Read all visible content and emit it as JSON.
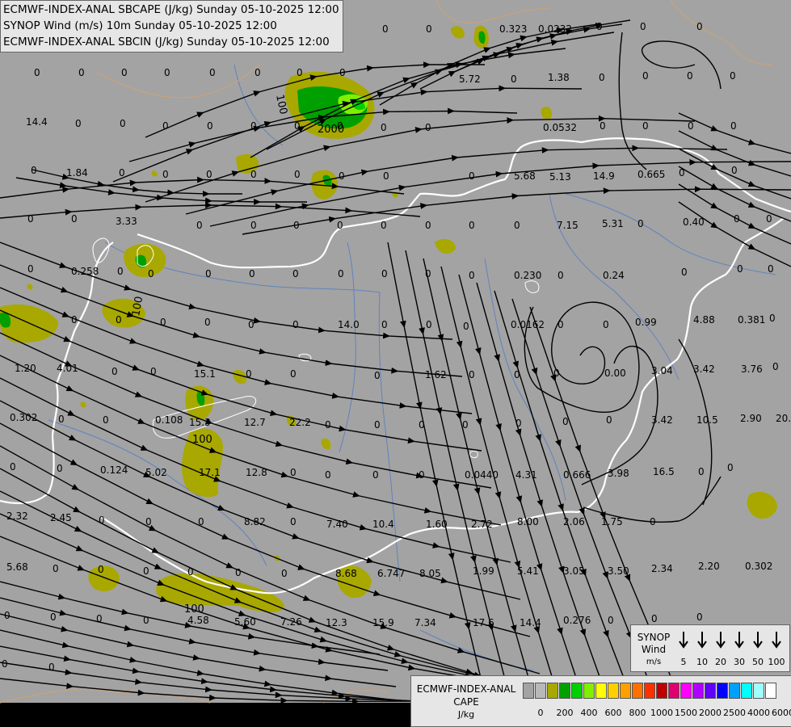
{
  "header": {
    "line1": "ECMWF-INDEX-ANAL SBCAPE (J/kg) Sunday 05-10-2025 12:00",
    "line2": "SYNOP Wind (m/s) 10m Sunday 05-10-2025 12:00",
    "line3": "ECMWF-INDEX-ANAL SBCIN (J/kg) Sunday 05-10-2025 12:00"
  },
  "wind_legend": {
    "title": "SYNOP",
    "subtitle": "Wind",
    "unit": "m/s",
    "speeds": [
      "5",
      "10",
      "20",
      "30",
      "50",
      "100"
    ]
  },
  "cape_legend": {
    "title": "ECMWF-INDEX-ANAL",
    "subtitle": "CAPE",
    "unit": "J/kg",
    "tick_labels": [
      "0",
      "200",
      "400",
      "600",
      "800",
      "1000",
      "1500",
      "2000",
      "2500",
      "4000",
      "6000"
    ],
    "colors": [
      "#a3a3a3",
      "#b8b8b8",
      "#a8a800",
      "#00a000",
      "#00d000",
      "#80f000",
      "#ffff00",
      "#ffd000",
      "#ffa000",
      "#ff7000",
      "#ff3000",
      "#c00000",
      "#e00070",
      "#ff00ff",
      "#b000ff",
      "#6000ff",
      "#0000ff",
      "#00a0ff",
      "#00ffff",
      "#a0ffff",
      "#ffffff"
    ]
  },
  "map": {
    "contour_labels": [
      {
        "text": "100"
      },
      {
        "text": "2000"
      },
      {
        "text": "100"
      },
      {
        "text": "100"
      },
      {
        "text": "100"
      }
    ],
    "station_values": [
      {
        "text": "0"
      },
      {
        "text": "0"
      },
      {
        "text": "0"
      },
      {
        "text": "0"
      },
      {
        "text": "0"
      },
      {
        "text": "0"
      },
      {
        "text": "0"
      },
      {
        "text": "0"
      },
      {
        "text": "0.323"
      },
      {
        "text": "0.0232"
      },
      {
        "text": "0"
      },
      {
        "text": "0"
      },
      {
        "text": "0"
      },
      {
        "text": "0"
      },
      {
        "text": "0"
      },
      {
        "text": "0"
      },
      {
        "text": "0"
      },
      {
        "text": "0"
      },
      {
        "text": "0"
      },
      {
        "text": "0"
      },
      {
        "text": "0"
      },
      {
        "text": "5.72"
      },
      {
        "text": "0"
      },
      {
        "text": "1.38"
      },
      {
        "text": "0"
      },
      {
        "text": "0"
      },
      {
        "text": "0"
      },
      {
        "text": "0"
      },
      {
        "text": "14.4"
      },
      {
        "text": "0"
      },
      {
        "text": "0"
      },
      {
        "text": "0"
      },
      {
        "text": "0"
      },
      {
        "text": "0"
      },
      {
        "text": "0"
      },
      {
        "text": "0"
      },
      {
        "text": "0"
      },
      {
        "text": "0"
      },
      {
        "text": "0.0532"
      },
      {
        "text": "0"
      },
      {
        "text": "0"
      },
      {
        "text": "0"
      },
      {
        "text": "0"
      },
      {
        "text": "0"
      },
      {
        "text": "1.84"
      },
      {
        "text": "0"
      },
      {
        "text": "0"
      },
      {
        "text": "0"
      },
      {
        "text": "0"
      },
      {
        "text": "0"
      },
      {
        "text": "0"
      },
      {
        "text": "0"
      },
      {
        "text": "0"
      },
      {
        "text": "5.68"
      },
      {
        "text": "5.13"
      },
      {
        "text": "14.9"
      },
      {
        "text": "0.665"
      },
      {
        "text": "0"
      },
      {
        "text": "0"
      },
      {
        "text": "0"
      },
      {
        "text": "0"
      },
      {
        "text": "3.33"
      },
      {
        "text": "0"
      },
      {
        "text": "0"
      },
      {
        "text": "0"
      },
      {
        "text": "0"
      },
      {
        "text": "0"
      },
      {
        "text": "0"
      },
      {
        "text": "0"
      },
      {
        "text": "0"
      },
      {
        "text": "7.15"
      },
      {
        "text": "5.31"
      },
      {
        "text": "0"
      },
      {
        "text": "0.40"
      },
      {
        "text": "0"
      },
      {
        "text": "0"
      },
      {
        "text": "0"
      },
      {
        "text": "0.258"
      },
      {
        "text": "0"
      },
      {
        "text": "0"
      },
      {
        "text": "0"
      },
      {
        "text": "0"
      },
      {
        "text": "0"
      },
      {
        "text": "0"
      },
      {
        "text": "0"
      },
      {
        "text": "0"
      },
      {
        "text": "0"
      },
      {
        "text": "0.230"
      },
      {
        "text": "0"
      },
      {
        "text": "0.24"
      },
      {
        "text": "0"
      },
      {
        "text": "0"
      },
      {
        "text": "0"
      },
      {
        "text": "0"
      },
      {
        "text": "0"
      },
      {
        "text": "0"
      },
      {
        "text": "0"
      },
      {
        "text": "0"
      },
      {
        "text": "0"
      },
      {
        "text": "14.0"
      },
      {
        "text": "0"
      },
      {
        "text": "0"
      },
      {
        "text": "0"
      },
      {
        "text": "0.0162"
      },
      {
        "text": "0"
      },
      {
        "text": "0"
      },
      {
        "text": "0.99"
      },
      {
        "text": "4.88"
      },
      {
        "text": "0.381"
      },
      {
        "text": "0"
      },
      {
        "text": "1.20"
      },
      {
        "text": "4.01"
      },
      {
        "text": "0"
      },
      {
        "text": "0"
      },
      {
        "text": "15.1"
      },
      {
        "text": "0"
      },
      {
        "text": "0"
      },
      {
        "text": "0"
      },
      {
        "text": "1.62"
      },
      {
        "text": "0"
      },
      {
        "text": "0"
      },
      {
        "text": "0"
      },
      {
        "text": "0.00"
      },
      {
        "text": "3.04"
      },
      {
        "text": "3.42"
      },
      {
        "text": "3.76"
      },
      {
        "text": "0"
      },
      {
        "text": "0.302"
      },
      {
        "text": "0"
      },
      {
        "text": "0"
      },
      {
        "text": "0.108"
      },
      {
        "text": "15.3"
      },
      {
        "text": "12.7"
      },
      {
        "text": "22.2"
      },
      {
        "text": "0"
      },
      {
        "text": "0"
      },
      {
        "text": "0"
      },
      {
        "text": "0"
      },
      {
        "text": "0"
      },
      {
        "text": "0"
      },
      {
        "text": "0"
      },
      {
        "text": "3.42"
      },
      {
        "text": "10.5"
      },
      {
        "text": "2.90"
      },
      {
        "text": "20.7"
      },
      {
        "text": "0"
      },
      {
        "text": "0"
      },
      {
        "text": "0.124"
      },
      {
        "text": "5.02"
      },
      {
        "text": "17.1"
      },
      {
        "text": "12.8"
      },
      {
        "text": "0"
      },
      {
        "text": "0"
      },
      {
        "text": "0"
      },
      {
        "text": "0"
      },
      {
        "text": "0.0440"
      },
      {
        "text": "4.31"
      },
      {
        "text": "0.666"
      },
      {
        "text": "3.98"
      },
      {
        "text": "16.5"
      },
      {
        "text": "0"
      },
      {
        "text": "0"
      },
      {
        "text": "2.32"
      },
      {
        "text": "2.45"
      },
      {
        "text": "0"
      },
      {
        "text": "0"
      },
      {
        "text": "0"
      },
      {
        "text": "8.82"
      },
      {
        "text": "0"
      },
      {
        "text": "7.40"
      },
      {
        "text": "10.4"
      },
      {
        "text": "1.60"
      },
      {
        "text": "2.72"
      },
      {
        "text": "8.00"
      },
      {
        "text": "2.06"
      },
      {
        "text": "1.75"
      },
      {
        "text": "0"
      },
      {
        "text": "5.68"
      },
      {
        "text": "0"
      },
      {
        "text": "0"
      },
      {
        "text": "0"
      },
      {
        "text": "0"
      },
      {
        "text": "0"
      },
      {
        "text": "0"
      },
      {
        "text": "8.68"
      },
      {
        "text": "6.747"
      },
      {
        "text": "8.05"
      },
      {
        "text": "1.99"
      },
      {
        "text": "5.41"
      },
      {
        "text": "3.05"
      },
      {
        "text": "3.50"
      },
      {
        "text": "2.34"
      },
      {
        "text": "2.20"
      },
      {
        "text": "0.302"
      },
      {
        "text": "0"
      },
      {
        "text": "0"
      },
      {
        "text": "0"
      },
      {
        "text": "0"
      },
      {
        "text": "4.58"
      },
      {
        "text": "5.60"
      },
      {
        "text": "7.26"
      },
      {
        "text": "12.3"
      },
      {
        "text": "15.9"
      },
      {
        "text": "7.34"
      },
      {
        "text": "17.6"
      },
      {
        "text": "14.4"
      },
      {
        "text": "0.276"
      },
      {
        "text": "0"
      },
      {
        "text": "0"
      },
      {
        "text": "0"
      },
      {
        "text": "0"
      },
      {
        "text": "0"
      }
    ]
  }
}
